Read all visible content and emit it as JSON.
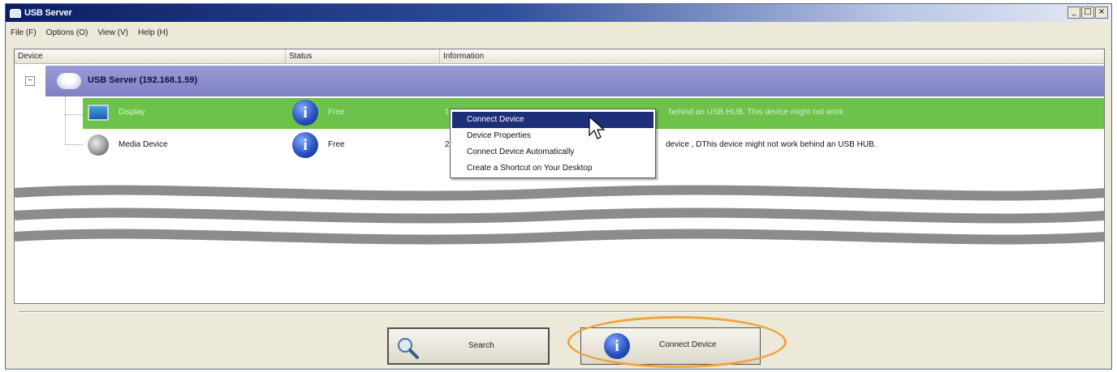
{
  "window": {
    "title": "USB Server",
    "controls": {
      "minimize": "_",
      "maximize": "□",
      "close": "×"
    }
  },
  "menu": {
    "items": [
      {
        "label": "File (F)"
      },
      {
        "label": "Options (O)"
      },
      {
        "label": "View (V)"
      },
      {
        "label": "Help (H)"
      }
    ]
  },
  "list": {
    "headers": {
      "device": "Device",
      "status": "Status",
      "information": "Information"
    },
    "server": {
      "label": "USB Server  (192.168.1.59)",
      "expander": "−"
    },
    "devices": [
      {
        "name": "Display",
        "status": "Free",
        "info_prefix": "1",
        "info_suffix": "behind an USB HUB. This device might not work",
        "selected": true
      },
      {
        "name": "Media Device",
        "status": "Free",
        "info_prefix": "2 (",
        "info_suffix": "device      , DThis device might not work behind an USB HUB.",
        "selected": false
      }
    ]
  },
  "context_menu": {
    "items": [
      {
        "label": "Connect Device",
        "highlighted": true
      },
      {
        "label": "Device Properties",
        "highlighted": false
      },
      {
        "label": "Connect Device Automatically",
        "highlighted": false
      },
      {
        "label": "Create a Shortcut on Your Desktop",
        "highlighted": false
      }
    ]
  },
  "buttons": {
    "search": "Search",
    "connect": "Connect Device"
  },
  "colors": {
    "selection": "#6cc24a",
    "server_row": "#8a8acd",
    "menu_highlight": "#1e2f7a",
    "callout": "#f0a341"
  },
  "icons": {
    "info": "i"
  }
}
